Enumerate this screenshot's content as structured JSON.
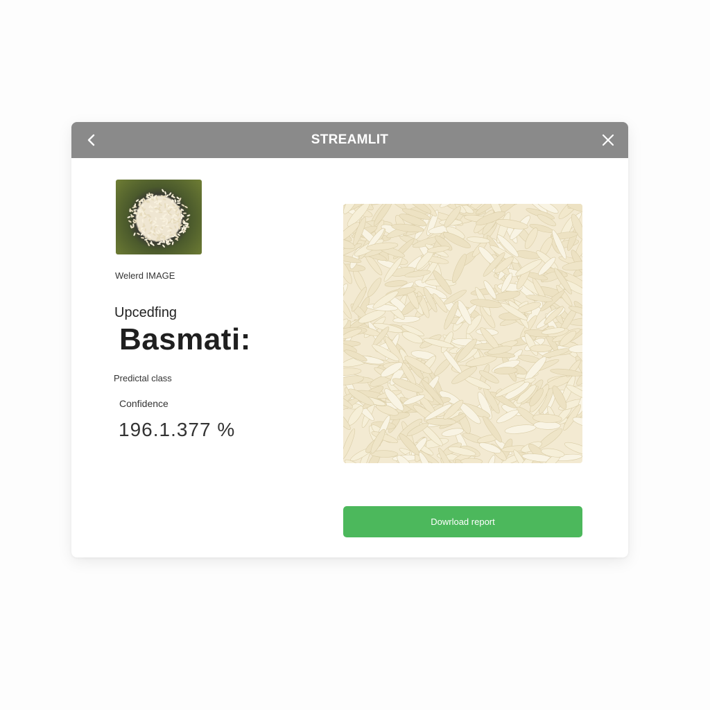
{
  "window": {
    "title": "STREAMLIT",
    "back_icon": "chevron-left-icon",
    "close_icon": "close-icon"
  },
  "upload": {
    "label": "Welerd IMAGE"
  },
  "result": {
    "heading": "Upcedfing",
    "predicted_value": "Basmati:",
    "predicted_label": "Predictal class",
    "confidence_label": "Confidence",
    "confidence_value": "196.1.377  %"
  },
  "actions": {
    "download_label": "Dowrload report"
  },
  "colors": {
    "titlebar": "#8a8a8a",
    "button": "#4cb85c"
  }
}
